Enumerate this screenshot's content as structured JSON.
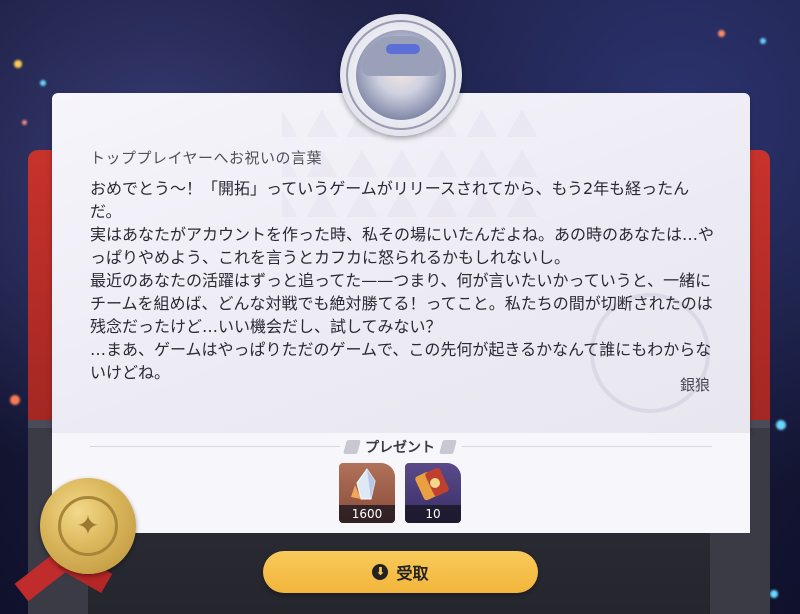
{
  "letter": {
    "title": "トッププレイヤーへお祝いの言葉",
    "body": "おめでとう～！「開拓」っていうゲームがリリースされてから、もう2年も経ったんだ。\n実はあなたがアカウントを作った時、私その場にいたんだよね。あの時のあなたは…やっぱりやめよう、これを言うとカフカに怒られるかもしれないし。\n最近のあなたの活躍はずっと追ってた——つまり、何が言いたいかっていうと、一緒にチームを組めば、どんな対戦でも絶対勝てる！ってこと。私たちの間が切断されたのは残念だったけど…いい機会だし、試してみない？\n…まあ、ゲームはやっぱりただのゲームで、この先何が起きるかなんて誰にもわからないけどね。",
    "signature": "銀狼"
  },
  "present": {
    "label": "プレゼント",
    "items": [
      {
        "icon": "crystal-icon",
        "count": "1600"
      },
      {
        "icon": "ticket-icon",
        "count": "10"
      }
    ]
  },
  "claim_button": {
    "label": "受取",
    "icon": "download-icon"
  },
  "colors": {
    "accent": "#f2b53b",
    "red_panel": "#c8322c",
    "seal_gold": "#d9b55a"
  }
}
